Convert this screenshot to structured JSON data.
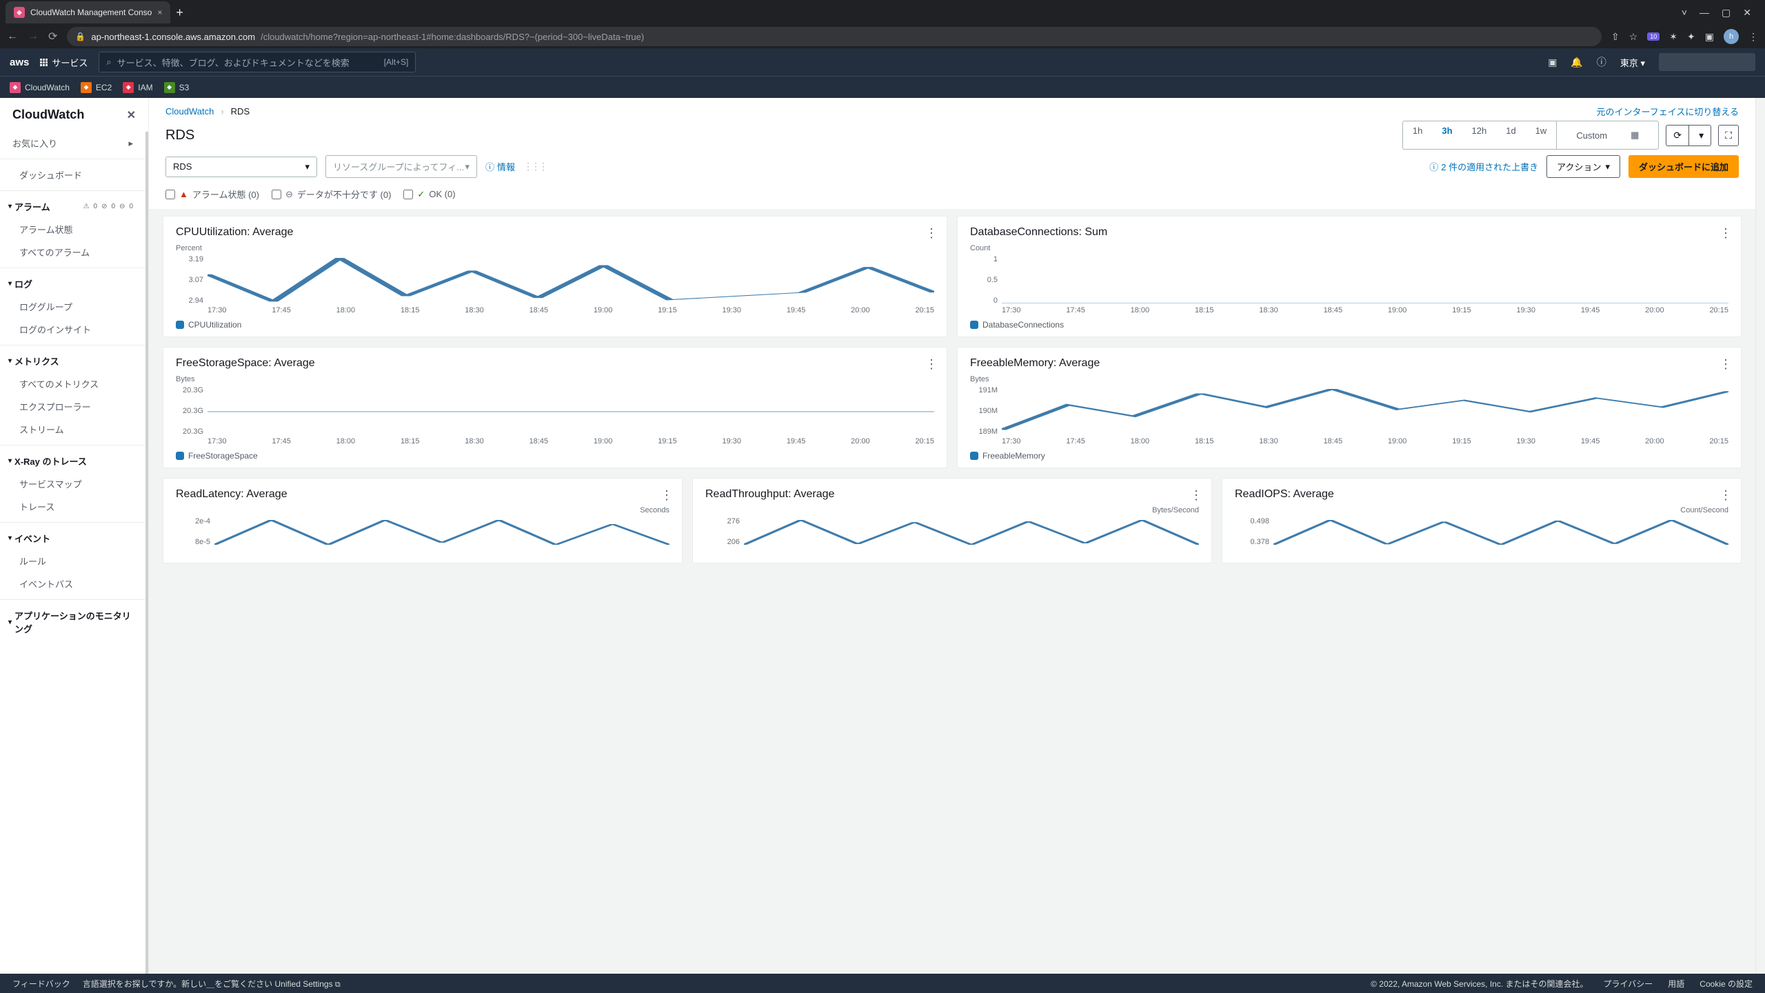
{
  "browser": {
    "tab_title": "CloudWatch Management Conso",
    "url_host": "ap-northeast-1.console.aws.amazon.com",
    "url_path": "/cloudwatch/home?region=ap-northeast-1#home:dashboards/RDS?~(period~300~liveData~true)",
    "ext_badge": "10",
    "avatar_letter": "h"
  },
  "aws_nav": {
    "logo": "aws",
    "services": "サービス",
    "search_placeholder": "サービス、特徴、ブログ、およびドキュメントなどを検索",
    "search_kbd": "[Alt+S]",
    "region": "東京 ▾",
    "sub": [
      "CloudWatch",
      "EC2",
      "IAM",
      "S3"
    ]
  },
  "sidebar": {
    "title": "CloudWatch",
    "favorites": "お気に入り",
    "items": {
      "dashboards": "ダッシュボード",
      "alarms": "アラーム",
      "alarm_state": "アラーム状態",
      "all_alarms": "すべてのアラーム",
      "logs": "ログ",
      "log_groups": "ロググループ",
      "log_insights": "ログのインサイト",
      "metrics": "メトリクス",
      "all_metrics": "すべてのメトリクス",
      "explorer": "エクスプローラー",
      "stream": "ストリーム",
      "xray": "X-Ray のトレース",
      "service_map": "サービスマップ",
      "trace": "トレース",
      "events": "イベント",
      "rules": "ルール",
      "event_bus": "イベントバス",
      "app_mon": "アプリケーションのモニタリング"
    },
    "alarm_badges": {
      "warn": "0",
      "ok": "0",
      "insuf": "0"
    }
  },
  "breadcrumb": {
    "root": "CloudWatch",
    "current": "RDS",
    "switch_ui": "元のインターフェイスに切り替える"
  },
  "heading": "RDS",
  "range": {
    "opts": [
      "1h",
      "3h",
      "12h",
      "1d",
      "1w"
    ],
    "active": "3h",
    "custom": "Custom"
  },
  "controls": {
    "ns_select": "RDS",
    "rg_placeholder": "リソースグループによってフィ...",
    "info": "情報",
    "override": "2 件の適用された上書き",
    "actions": "アクション",
    "add": "ダッシュボードに追加"
  },
  "filters": {
    "alarm": "アラーム状態 (0)",
    "insufficient": "データが不十分です (0)",
    "ok": "OK (0)"
  },
  "x_ticks": [
    "17:30",
    "17:45",
    "18:00",
    "18:15",
    "18:30",
    "18:45",
    "19:00",
    "19:15",
    "19:30",
    "19:45",
    "20:00",
    "20:15"
  ],
  "widgets": [
    {
      "title": "CPUUtilization: Average",
      "unit": "Percent",
      "y": [
        "3.19",
        "3.07",
        "2.94"
      ],
      "legend": "CPUUtilization"
    },
    {
      "title": "DatabaseConnections: Sum",
      "unit": "Count",
      "y": [
        "1",
        "0.5",
        "0"
      ],
      "legend": "DatabaseConnections"
    },
    {
      "title": "FreeStorageSpace: Average",
      "unit": "Bytes",
      "y": [
        "20.3G",
        "20.3G",
        "20.3G"
      ],
      "legend": "FreeStorageSpace"
    },
    {
      "title": "FreeableMemory: Average",
      "unit": "Bytes",
      "y": [
        "191M",
        "190M",
        "189M"
      ],
      "legend": "FreeableMemory"
    },
    {
      "title": "ReadLatency: Average",
      "unit": "Seconds",
      "y": [
        "2e-4",
        "8e-5"
      ],
      "legend": ""
    },
    {
      "title": "ReadThroughput: Average",
      "unit": "Bytes/Second",
      "y": [
        "276",
        "206"
      ],
      "legend": ""
    },
    {
      "title": "ReadIOPS: Average",
      "unit": "Count/Second",
      "y": [
        "0.498",
        "0.378"
      ],
      "legend": ""
    }
  ],
  "chart_data": [
    {
      "type": "line",
      "title": "CPUUtilization: Average",
      "ylabel": "Percent",
      "x": [
        "17:30",
        "17:45",
        "18:00",
        "18:15",
        "18:30",
        "18:45",
        "19:00",
        "19:15",
        "19:30",
        "19:45",
        "20:00",
        "20:15"
      ],
      "series": [
        {
          "name": "CPUUtilization",
          "values": [
            3.1,
            2.95,
            3.19,
            2.98,
            3.12,
            2.97,
            3.15,
            2.96,
            2.98,
            3.0,
            3.14,
            3.0
          ]
        }
      ],
      "ylim": [
        2.94,
        3.19
      ]
    },
    {
      "type": "line",
      "title": "DatabaseConnections: Sum",
      "ylabel": "Count",
      "x": [
        "17:30",
        "17:45",
        "18:00",
        "18:15",
        "18:30",
        "18:45",
        "19:00",
        "19:15",
        "19:30",
        "19:45",
        "20:00",
        "20:15"
      ],
      "series": [
        {
          "name": "DatabaseConnections",
          "values": [
            0,
            0,
            0,
            0,
            0,
            0,
            0,
            0,
            0,
            0,
            0,
            0
          ]
        }
      ],
      "ylim": [
        0,
        1
      ]
    },
    {
      "type": "line",
      "title": "FreeStorageSpace: Average",
      "ylabel": "Bytes",
      "x": [
        "17:30",
        "17:45",
        "18:00",
        "18:15",
        "18:30",
        "18:45",
        "19:00",
        "19:15",
        "19:30",
        "19:45",
        "20:00",
        "20:15"
      ],
      "series": [
        {
          "name": "FreeStorageSpace",
          "values": [
            20.3,
            20.3,
            20.3,
            20.3,
            20.3,
            20.3,
            20.3,
            20.3,
            20.3,
            20.3,
            20.3,
            20.3
          ]
        }
      ],
      "ylim": [
        20.3,
        20.3
      ],
      "unit": "G"
    },
    {
      "type": "line",
      "title": "FreeableMemory: Average",
      "ylabel": "Bytes",
      "x": [
        "17:30",
        "17:45",
        "18:00",
        "18:15",
        "18:30",
        "18:45",
        "19:00",
        "19:15",
        "19:30",
        "19:45",
        "20:00",
        "20:15"
      ],
      "series": [
        {
          "name": "FreeableMemory",
          "values": [
            189.2,
            190.3,
            189.8,
            190.8,
            190.2,
            191.0,
            190.1,
            190.5,
            190.0,
            190.6,
            190.2,
            190.9
          ]
        }
      ],
      "ylim": [
        189,
        191
      ],
      "unit": "M"
    },
    {
      "type": "line",
      "title": "ReadLatency: Average",
      "ylabel": "Seconds",
      "series": [
        {
          "name": "ReadLatency",
          "values": [
            8e-05,
            0.0002,
            8e-05,
            0.0002,
            9e-05,
            0.0002,
            8e-05,
            0.00018,
            8e-05
          ]
        }
      ],
      "ylim": [
        8e-05,
        0.0002
      ]
    },
    {
      "type": "line",
      "title": "ReadThroughput: Average",
      "ylabel": "Bytes/Second",
      "series": [
        {
          "name": "ReadThroughput",
          "values": [
            206,
            276,
            208,
            270,
            206,
            272,
            210,
            276,
            206
          ]
        }
      ],
      "ylim": [
        206,
        276
      ]
    },
    {
      "type": "line",
      "title": "ReadIOPS: Average",
      "ylabel": "Count/Second",
      "series": [
        {
          "name": "ReadIOPS",
          "values": [
            0.378,
            0.498,
            0.38,
            0.49,
            0.378,
            0.495,
            0.382,
            0.498,
            0.378
          ]
        }
      ],
      "ylim": [
        0.378,
        0.498
      ]
    }
  ],
  "footer": {
    "feedback": "フィードバック",
    "lang_hint": "言語選択をお探しですか。新しい＿をご覧ください",
    "unified": "Unified Settings",
    "copyright": "© 2022, Amazon Web Services, Inc. またはその関連会社。",
    "links": [
      "プライバシー",
      "用語",
      "Cookie の設定"
    ]
  }
}
